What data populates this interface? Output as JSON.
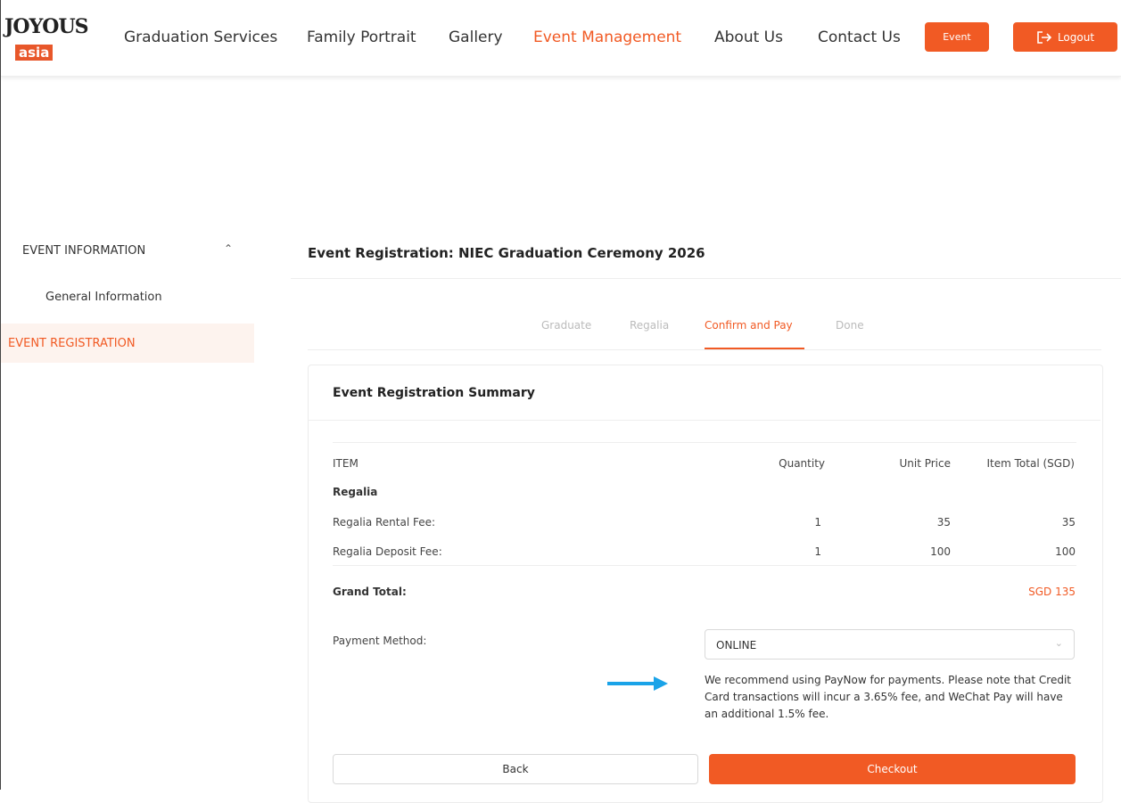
{
  "header": {
    "logo_top": "JOYOUS",
    "logo_bottom": "asia",
    "nav": [
      {
        "label": "Graduation Services"
      },
      {
        "label": "Family Portrait"
      },
      {
        "label": "Gallery"
      },
      {
        "label": "Event Management"
      },
      {
        "label": "About Us"
      },
      {
        "label": "Contact Us"
      }
    ],
    "event_button": "Event",
    "logout_button": "Logout",
    "logout_icon": "logout-icon",
    "accent_color": "#f15a24"
  },
  "sidebar": {
    "section": "EVENT INFORMATION",
    "section_icon": "chevron-up-icon",
    "sub_item": "General Information",
    "active_item": "EVENT REGISTRATION"
  },
  "main": {
    "title": "Event Registration: NIEC Graduation Ceremony 2026",
    "steps": [
      {
        "label": "Graduate"
      },
      {
        "label": "Regalia"
      },
      {
        "label": "Confirm and Pay"
      },
      {
        "label": "Done"
      }
    ],
    "summary": {
      "title": "Event Registration Summary",
      "columns": [
        "ITEM",
        "Quantity",
        "Unit Price",
        "Item Total (SGD)"
      ],
      "group": "Regalia",
      "rows": [
        {
          "item": "Regalia Rental Fee:",
          "quantity": "1",
          "unit_price": "35",
          "total": "35"
        },
        {
          "item": "Regalia Deposit Fee:",
          "quantity": "1",
          "unit_price": "100",
          "total": "100"
        }
      ],
      "grand_total_label": "Grand Total:",
      "grand_total_value": "SGD 135",
      "payment_label": "Payment Method:",
      "payment_value": "ONLINE",
      "note": "We recommend using PayNow for payments. Please note that Credit Card transactions will incur a 3.65% fee, and WeChat Pay will have an additional 1.5% fee.",
      "back_button": "Back",
      "checkout_button": "Checkout"
    }
  }
}
